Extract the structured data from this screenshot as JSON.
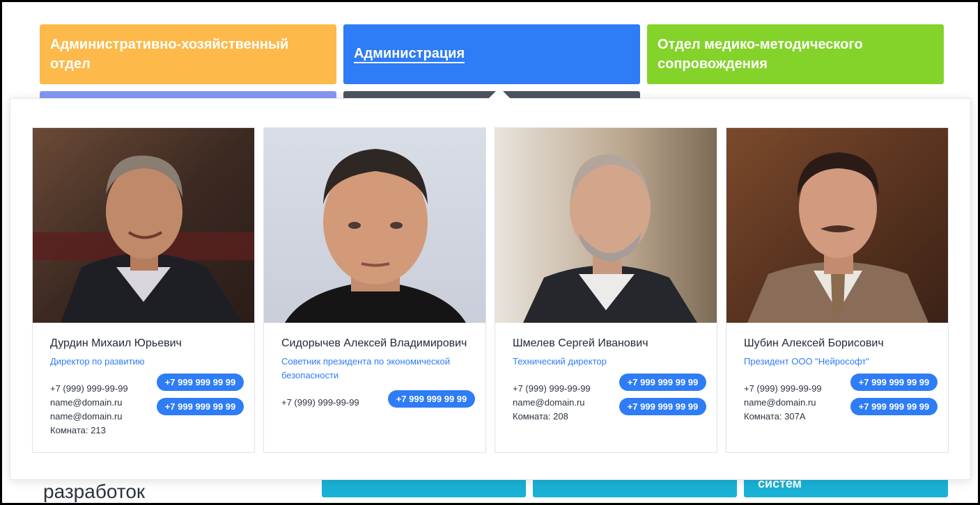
{
  "tabs": {
    "household": "Административно-хозяйственный отдел",
    "admin": "Администрация",
    "med": "Отдел медико-методического сопровождения"
  },
  "background": {
    "section_title": "разработок",
    "tile3_label": "систем"
  },
  "colors": {
    "orange": "#fdb94a",
    "blue": "#2e7cf6",
    "green": "#84d32a",
    "purple": "#8596f3",
    "dark": "#4c5462",
    "cyan": "#1ab1d6"
  },
  "employees": [
    {
      "name": "Дурдин Михаил Юрьевич",
      "role": "Директор по развитию",
      "phone": "+7 (999) 999-99-99",
      "email1": "name@domain.ru",
      "email2": "name@domain.ru",
      "room": "Комната: 213",
      "buttons": [
        "+7 999 999 99 99",
        "+7 999 999 99 99"
      ]
    },
    {
      "name": "Сидорычев Алексей Владимирович",
      "role": "Советник президента по экономической безопасности",
      "phone": "+7 (999) 999-99-99",
      "buttons": [
        "+7 999 999 99 99"
      ]
    },
    {
      "name": "Шмелев Сергей Иванович",
      "role": "Технический директор",
      "phone": "+7 (999) 999-99-99",
      "email1": "name@domain.ru",
      "room": "Комната: 208",
      "buttons": [
        "+7 999 999 99 99",
        "+7 999 999 99 99"
      ]
    },
    {
      "name": "Шубин Алексей Борисович",
      "role": "Президент ООО \"Нейрософт\"",
      "phone": "+7 (999) 999-99-99",
      "email1": "name@domain.ru",
      "room": "Комната: 307А",
      "buttons": [
        "+7 999 999 99 99",
        "+7 999 999 99 99"
      ]
    }
  ]
}
